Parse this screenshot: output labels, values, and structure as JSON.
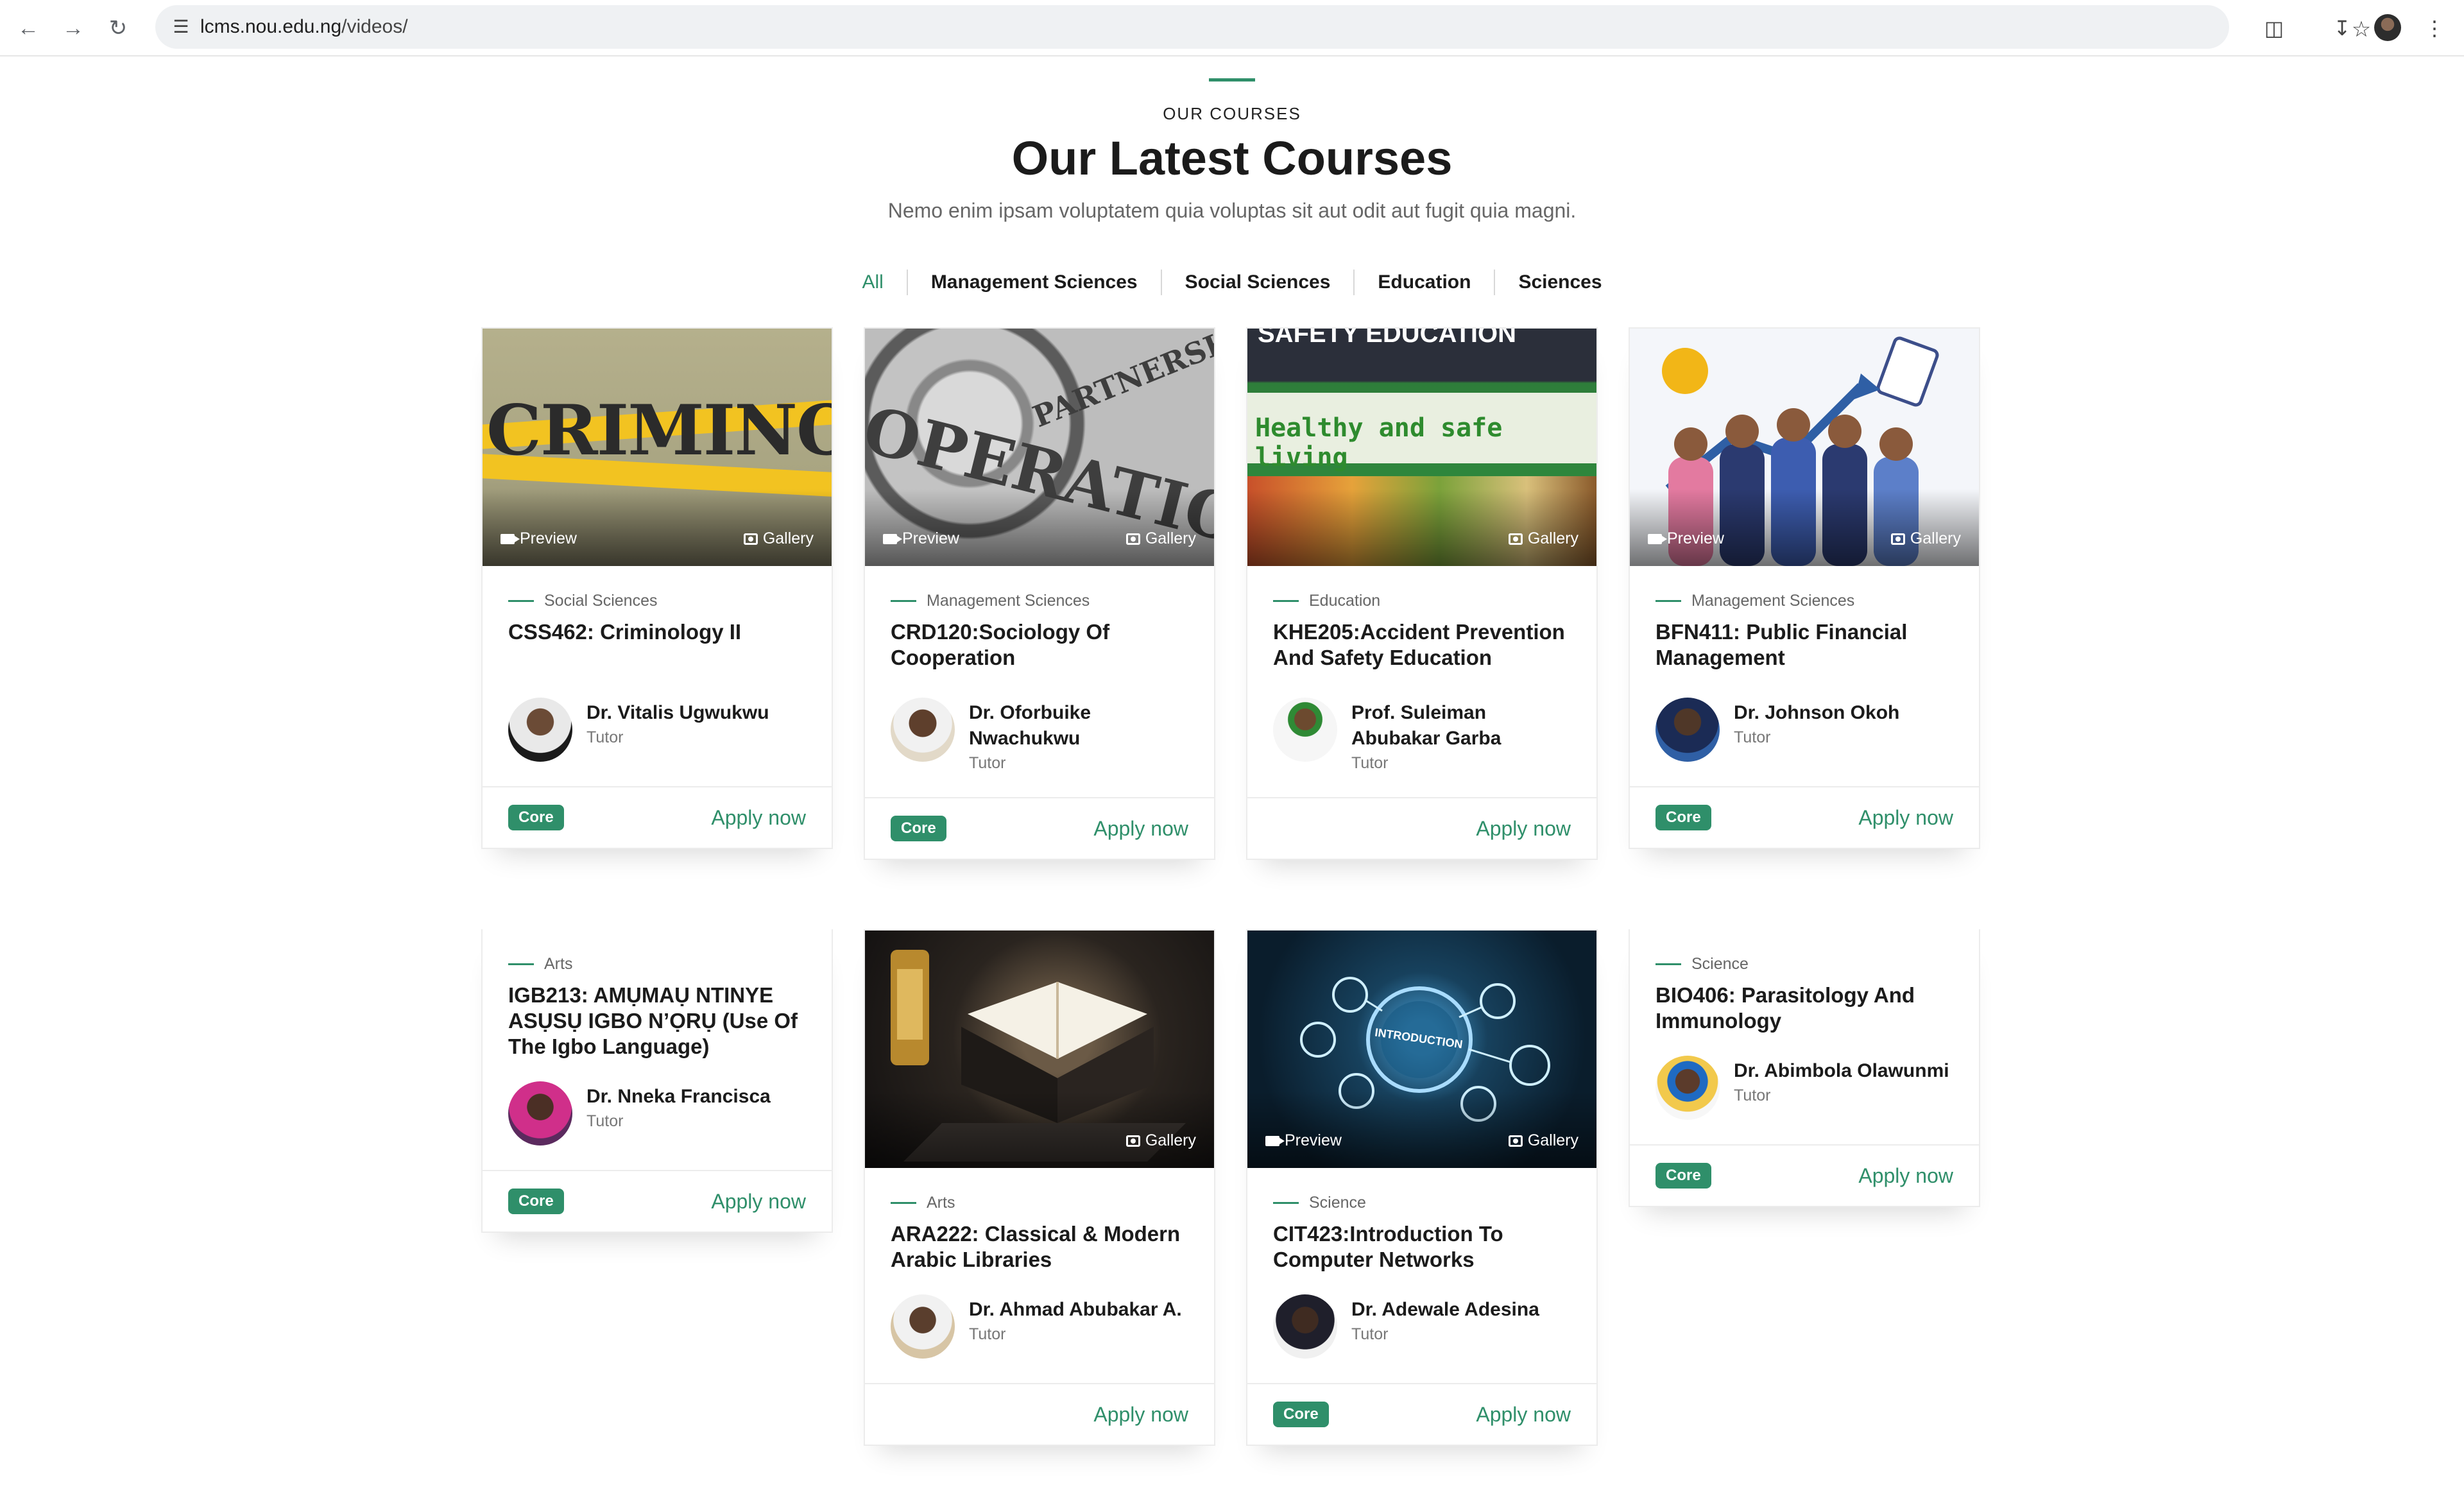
{
  "browser": {
    "url_host": "lcms.nou.edu.ng",
    "url_path": "/videos/"
  },
  "header": {
    "eyebrow": "OUR COURSES",
    "title": "Our Latest Courses",
    "subtitle": "Nemo enim ipsam voluptatem quia voluptas sit aut odit aut fugit quia magni."
  },
  "filters": [
    "All",
    "Management Sciences",
    "Social Sciences",
    "Education",
    "Sciences"
  ],
  "labels": {
    "preview": "Preview",
    "gallery": "Gallery",
    "apply": "Apply now",
    "core": "Core"
  },
  "courses": [
    {
      "category": "Social Sciences",
      "title": "CSS462: Criminology II",
      "tutor": "Dr. Vitalis Ugwukwu",
      "role": "Tutor",
      "thumb_text": "CRIMINOLOGY"
    },
    {
      "category": "Management Sciences",
      "title": "CRD120:Sociology Of Cooperation",
      "tutor": "Dr. Oforbuike Nwachukwu",
      "role": "Tutor",
      "thumb_text_1": "PARTNERSHIP",
      "thumb_text_2": "OPERATION"
    },
    {
      "category": "Education",
      "title": "KHE205:Accident Prevention And Safety Education",
      "tutor": "Prof. Suleiman Abubakar Garba",
      "role": "Tutor",
      "thumb_text_1": "SAFETY EDUCATION",
      "thumb_text_2": "Healthy and safe living"
    },
    {
      "category": "Management Sciences",
      "title": "BFN411: Public Financial Management",
      "tutor": "Dr. Johnson Okoh",
      "role": "Tutor"
    },
    {
      "category": "Arts",
      "title": "IGB213: AMỤMAỤ NTINYE ASỤSỤ IGBO N’ỌRỤ (Use Of The Igbo Language)",
      "tutor": "Dr. Nneka Francisca",
      "role": "Tutor"
    },
    {
      "category": "Arts",
      "title": "ARA222: Classical & Modern Arabic Libraries",
      "tutor": "Dr. Ahmad Abubakar A.",
      "role": "Tutor"
    },
    {
      "category": "Science",
      "title": "CIT423:Introduction To Computer Networks",
      "tutor": "Dr. Adewale Adesina",
      "role": "Tutor",
      "thumb_text": "INTRODUCTION"
    },
    {
      "category": "Science",
      "title": "BIO406: Parasitology And Immunology",
      "tutor": "Dr. Abimbola Olawunmi",
      "role": "Tutor"
    }
  ],
  "colors": {
    "accent": "#2f8f6a"
  }
}
